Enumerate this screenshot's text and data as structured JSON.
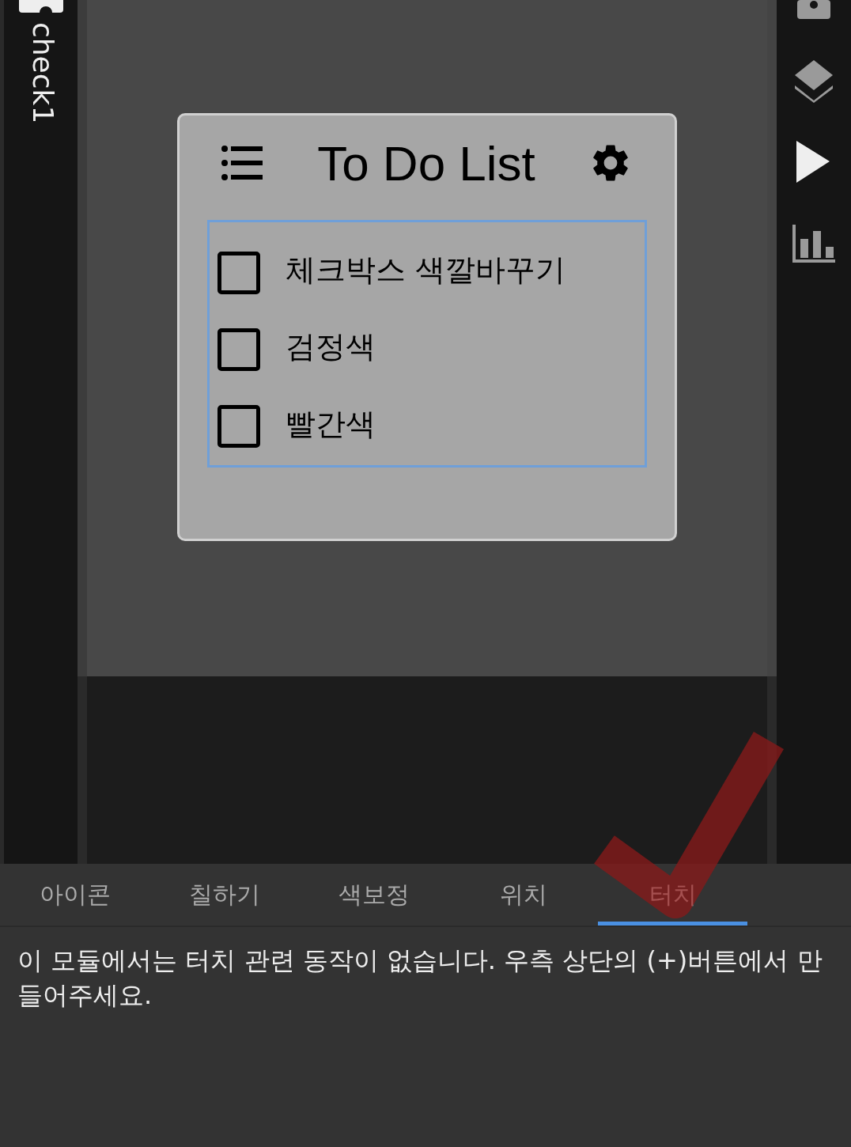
{
  "left_sidebar": {
    "label": "check1"
  },
  "widget": {
    "title": "To Do List",
    "items": [
      {
        "label": "체크박스 색깔바꾸기",
        "checked": false
      },
      {
        "label": "검정색",
        "checked": false
      },
      {
        "label": "빨간색",
        "checked": false
      }
    ]
  },
  "tabs": [
    {
      "label": "아이콘",
      "selected": false
    },
    {
      "label": "칠하기",
      "selected": false
    },
    {
      "label": "색보정",
      "selected": false
    },
    {
      "label": "위치",
      "selected": false
    },
    {
      "label": "터치",
      "selected": true
    }
  ],
  "message": "이 모듈에서는 터치 관련 동작이 없습니다. 우측 상단의 (+)버튼에서 만들어주세요."
}
